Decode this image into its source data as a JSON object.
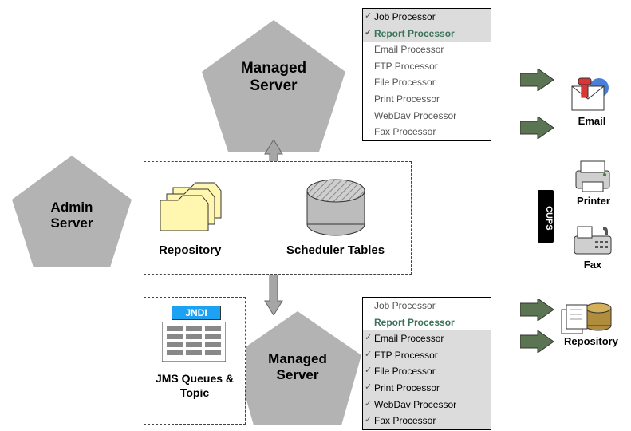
{
  "diagram": {
    "admin": "Admin Server",
    "managed_top": "Managed Server",
    "managed_bottom": "Managed Server",
    "repository": "Repository",
    "scheduler": "Scheduler Tables",
    "jndi": "JNDI",
    "jms": "JMS Queues & Topic"
  },
  "processors_top": {
    "items": [
      {
        "label": "Job Processor",
        "checked": true,
        "gray": true,
        "green": false
      },
      {
        "label": "Report Processor",
        "checked": true,
        "gray": true,
        "green": true
      },
      {
        "label": "Email Processor",
        "checked": false,
        "gray": false,
        "green": false
      },
      {
        "label": "FTP Processor",
        "checked": false,
        "gray": false,
        "green": false
      },
      {
        "label": "File Processor",
        "checked": false,
        "gray": false,
        "green": false
      },
      {
        "label": "Print Processor",
        "checked": false,
        "gray": false,
        "green": false
      },
      {
        "label": "WebDav Processor",
        "checked": false,
        "gray": false,
        "green": false
      },
      {
        "label": "Fax Processor",
        "checked": false,
        "gray": false,
        "green": false
      }
    ]
  },
  "processors_bottom": {
    "items": [
      {
        "label": "Job Processor",
        "checked": false,
        "gray": false,
        "green": false
      },
      {
        "label": "Report Processor",
        "checked": false,
        "gray": false,
        "green": true
      },
      {
        "label": "Email Processor",
        "checked": true,
        "gray": true,
        "green": false
      },
      {
        "label": "FTP Processor",
        "checked": true,
        "gray": true,
        "green": false
      },
      {
        "label": "File Processor",
        "checked": true,
        "gray": true,
        "green": false
      },
      {
        "label": "Print Processor",
        "checked": true,
        "gray": true,
        "green": false
      },
      {
        "label": "WebDav Processor",
        "checked": true,
        "gray": true,
        "green": false
      },
      {
        "label": "Fax Processor",
        "checked": true,
        "gray": true,
        "green": false
      }
    ]
  },
  "outputs": {
    "email": "Email",
    "printer": "Printer",
    "fax": "Fax",
    "repository": "Repository",
    "cups": "CUPS"
  }
}
